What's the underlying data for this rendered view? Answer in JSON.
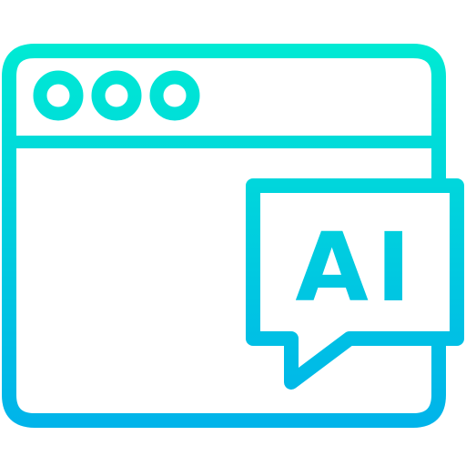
{
  "icon": {
    "semantic": "browser-window-ai-chat-icon",
    "badge_text": "AI",
    "window_dots": [
      "dot-1",
      "dot-2",
      "dot-3"
    ]
  },
  "colors": {
    "gradient_top": "#00EBD3",
    "gradient_bottom": "#00B3EA",
    "background": "#FFFFFF"
  }
}
